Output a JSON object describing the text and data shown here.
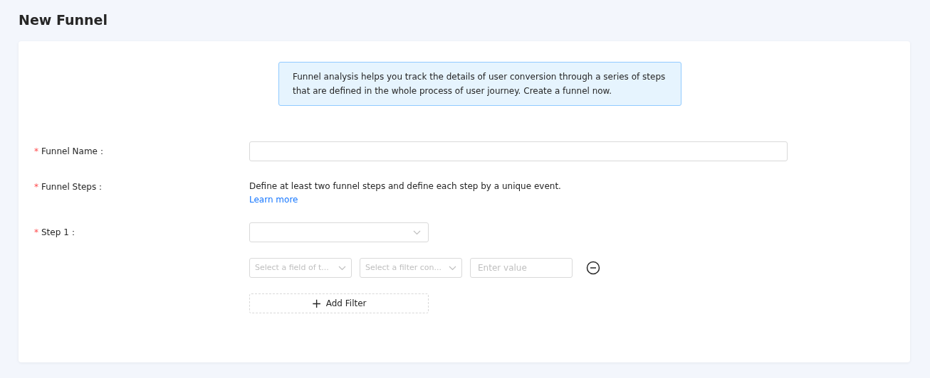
{
  "page": {
    "title": "New Funnel"
  },
  "info": "Funnel analysis helps you track the details of user conversion through a series of steps that are defined in the whole process of user journey. Create a funnel now.",
  "form": [
    {
      "kind": "text-input",
      "mark": "*",
      "label": "Funnel Name："
    },
    {
      "kind": "note",
      "mark": "*",
      "label": "Funnel Steps：",
      "text": "Define at least two funnel steps and define each step by a unique event.",
      "link": "Learn more"
    },
    {
      "kind": "select",
      "mark": "*",
      "label": "Step 1："
    }
  ],
  "filter": {
    "field_placeholder": "Select a field of t...",
    "condition_placeholder": "Select a filter con...",
    "value_placeholder": "Enter value"
  },
  "add_filter": {
    "icon": "+",
    "label": "Add Filter"
  }
}
